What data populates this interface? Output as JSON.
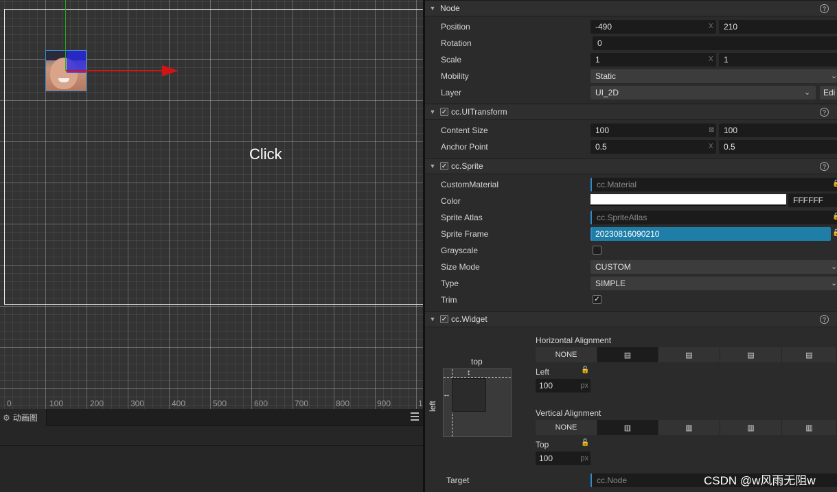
{
  "scene": {
    "click_label": "Click",
    "ruler_labels": [
      "0",
      "100",
      "200",
      "300",
      "400",
      "500",
      "600",
      "700",
      "800",
      "900",
      "1"
    ]
  },
  "animation_panel": {
    "tab_label": "动画图"
  },
  "inspector": {
    "node": {
      "title": "Node",
      "position_label": "Position",
      "position_x": "-490",
      "position_y": "210",
      "rotation_label": "Rotation",
      "rotation": "0",
      "scale_label": "Scale",
      "scale_x": "1",
      "scale_y": "1",
      "mobility_label": "Mobility",
      "mobility": "Static",
      "layer_label": "Layer",
      "layer": "UI_2D",
      "layer_edit": "Edi",
      "axis_x": "X"
    },
    "ui_transform": {
      "title": "cc.UITransform",
      "content_size_label": "Content Size",
      "width": "100",
      "height": "100",
      "anchor_point_label": "Anchor Point",
      "anchor_x": "0.5",
      "anchor_y": "0.5"
    },
    "sprite": {
      "title": "cc.Sprite",
      "custom_material_label": "CustomMaterial",
      "custom_material": "cc.Material",
      "color_label": "Color",
      "color_hex": "FFFFFF",
      "sprite_atlas_label": "Sprite Atlas",
      "sprite_atlas": "cc.SpriteAtlas",
      "sprite_frame_label": "Sprite Frame",
      "sprite_frame": "20230816090210",
      "grayscale_label": "Grayscale",
      "size_mode_label": "Size Mode",
      "size_mode": "CUSTOM",
      "type_label": "Type",
      "type": "SIMPLE",
      "trim_label": "Trim"
    },
    "widget": {
      "title": "cc.Widget",
      "diagram_top": "top",
      "diagram_left": "left",
      "horizontal_alignment_label": "Horizontal Alignment",
      "vertical_alignment_label": "Vertical Alignment",
      "none": "NONE",
      "left_label": "Left",
      "left_value": "100",
      "top_label": "Top",
      "top_value": "100",
      "unit": "px",
      "target_label": "Target",
      "target": "cc.Node"
    }
  },
  "watermark": "CSDN @w风雨无阻w",
  "colors": {
    "accent": "#2f8ccc",
    "frame_highlight": "#1f7ea8",
    "gizmo_x": "#d31414",
    "gizmo_y": "#1fb01f"
  }
}
